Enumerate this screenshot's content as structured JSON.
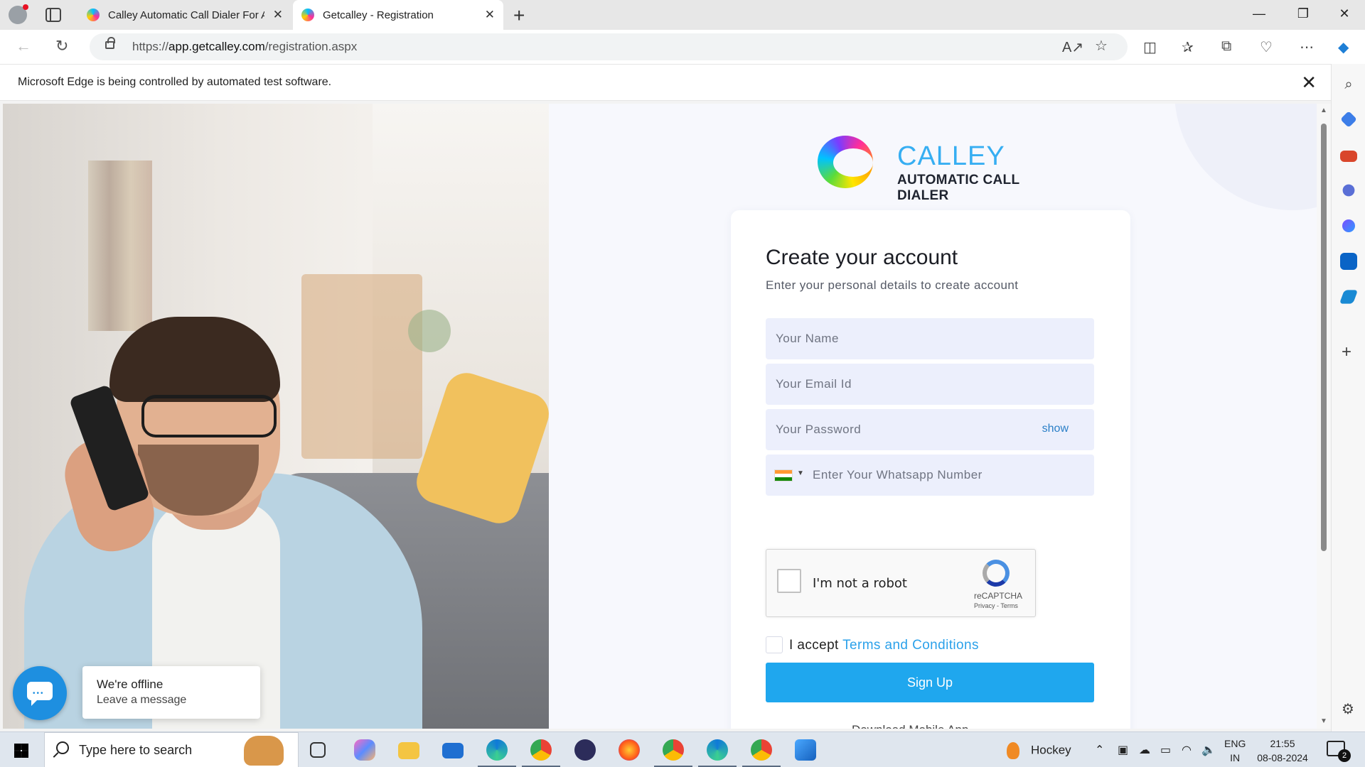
{
  "browser": {
    "tabs": [
      {
        "title": "Calley Automatic Call Dialer For A",
        "active": false
      },
      {
        "title": "Getcalley - Registration",
        "active": true
      }
    ],
    "address": {
      "prefix": "https://",
      "host": "app.getcalley.com",
      "path": "/registration.aspx"
    },
    "infobar": {
      "message": "Microsoft Edge is being controlled by automated test software."
    }
  },
  "page": {
    "logo": {
      "name": "CALLEY",
      "tagline": "AUTOMATIC CALL DIALER"
    },
    "form": {
      "title": "Create your account",
      "subtitle": "Enter your personal details to create account",
      "name_placeholder": "Your Name",
      "email_placeholder": "Your Email Id",
      "password_placeholder": "Your Password",
      "password_toggle": "show",
      "whatsapp_placeholder": "Enter Your Whatsapp Number",
      "country_flag": "india-flag-icon",
      "captcha": {
        "label": "I'm not a robot",
        "brand": "reCAPTCHA",
        "links": "Privacy - Terms"
      },
      "terms_prefix": "I accept",
      "terms_link": "Terms and Conditions",
      "submit_label": "Sign Up",
      "below_text": "Download Mobile App"
    },
    "chat": {
      "status": "We're offline",
      "action": "Leave a message"
    }
  },
  "taskbar": {
    "search_placeholder": "Type here to search",
    "weather": "Hockey",
    "language": {
      "code": "ENG",
      "region": "IN"
    },
    "time": "21:55",
    "date": "08-08-2024",
    "notification_count": "2"
  },
  "colors": {
    "accent": "#1fa7ee",
    "brand": "#36aef2",
    "field_bg": "#eceffc"
  }
}
